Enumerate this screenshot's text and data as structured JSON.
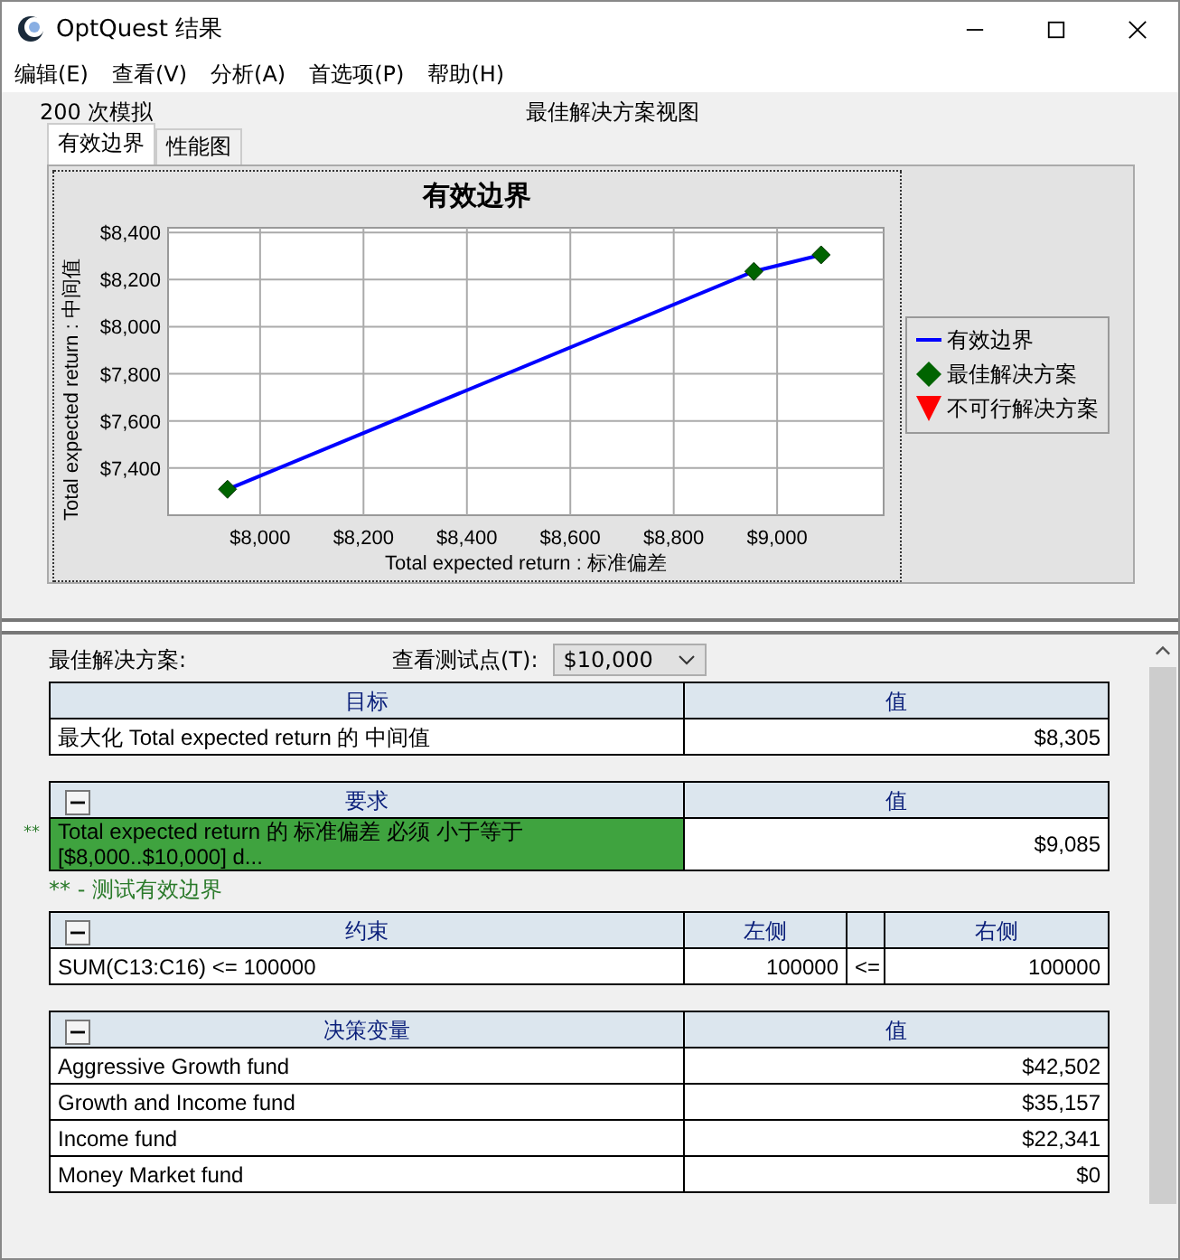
{
  "window": {
    "title": "OptQuest 结果"
  },
  "menu": [
    "编辑(E)",
    "查看(V)",
    "分析(A)",
    "首选项(P)",
    "帮助(H)"
  ],
  "header": {
    "simulations": "200 次模拟",
    "view_title": "最佳解决方案视图"
  },
  "tabs": [
    {
      "label": "有效边界",
      "selected": true
    },
    {
      "label": "性能图",
      "selected": false
    }
  ],
  "chart": {
    "chart_data": {
      "type": "line",
      "title": "有效边界",
      "xlabel": "Total expected return : 标准偏差",
      "ylabel": "Total expected return : 中间值",
      "x": [
        7937,
        8955,
        9085
      ],
      "series": [
        {
          "name": "有效边界",
          "color": "#0000ff",
          "marker": "diamond",
          "values": [
            7310,
            8235,
            8305
          ]
        }
      ],
      "grid": true,
      "xlim": [
        7822,
        9206
      ],
      "ylim": [
        7200,
        8420
      ],
      "xticks": [
        {
          "value": 8000,
          "label": "$8,000"
        },
        {
          "value": 8200,
          "label": "$8,200"
        },
        {
          "value": 8400,
          "label": "$8,400"
        },
        {
          "value": 8600,
          "label": "$8,600"
        },
        {
          "value": 8800,
          "label": "$8,800"
        },
        {
          "value": 9000,
          "label": "$9,000"
        }
      ],
      "yticks": [
        {
          "value": 7400,
          "label": "$7,400"
        },
        {
          "value": 7600,
          "label": "$7,600"
        },
        {
          "value": 7800,
          "label": "$7,800"
        },
        {
          "value": 8000,
          "label": "$8,000"
        },
        {
          "value": 8200,
          "label": "$8,200"
        },
        {
          "value": 8400,
          "label": "$8,400"
        }
      ]
    },
    "legend": [
      {
        "kind": "line"
      },
      {
        "kind": "diamond",
        "label": "最佳解决方案",
        "color": "#006400"
      },
      {
        "kind": "triangle",
        "label": "不可行解决方案",
        "color": "#ff0000"
      }
    ]
  },
  "solution": {
    "label": "最佳解决方案:",
    "test_point_label": "查看测试点(T):",
    "test_point_value": "$10,000"
  },
  "sections": [
    {
      "kind": "two_col",
      "columns": [
        "目标",
        "值"
      ],
      "rows": [
        {
          "highlighted": false,
          "cells": [
            "最大化 Total expected return 的 中间值",
            "$8,305"
          ]
        }
      ]
    },
    {
      "kind": "two_col",
      "expanded": true,
      "columns": [
        "要求",
        "值"
      ],
      "rows": [
        {
          "highlighted": true,
          "marker": "**",
          "cells": [
            "Total expected return 的 标准偏差 必须 小于等于 [$8,000..$10,000] d...",
            "$9,085"
          ]
        }
      ],
      "note": "** - 测试有效边界"
    },
    {
      "kind": "constraint",
      "expanded": true,
      "columns": [
        "约束",
        "左侧",
        "",
        "右侧"
      ],
      "rows": [
        {
          "highlighted": false,
          "cells": [
            "SUM(C13:C16) <= 100000",
            "100000",
            "<=",
            "100000"
          ]
        }
      ]
    },
    {
      "kind": "two_col",
      "expanded": true,
      "columns": [
        "决策变量",
        "值"
      ],
      "rows": [
        {
          "highlighted": false,
          "cells": [
            "Aggressive Growth fund",
            "$42,502"
          ]
        },
        {
          "highlighted": false,
          "cells": [
            "Growth and Income fund",
            "$35,157"
          ]
        },
        {
          "highlighted": false,
          "cells": [
            "Income fund",
            "$22,341"
          ]
        },
        {
          "highlighted": false,
          "cells": [
            "Money Market fund",
            "$0"
          ]
        }
      ]
    }
  ]
}
